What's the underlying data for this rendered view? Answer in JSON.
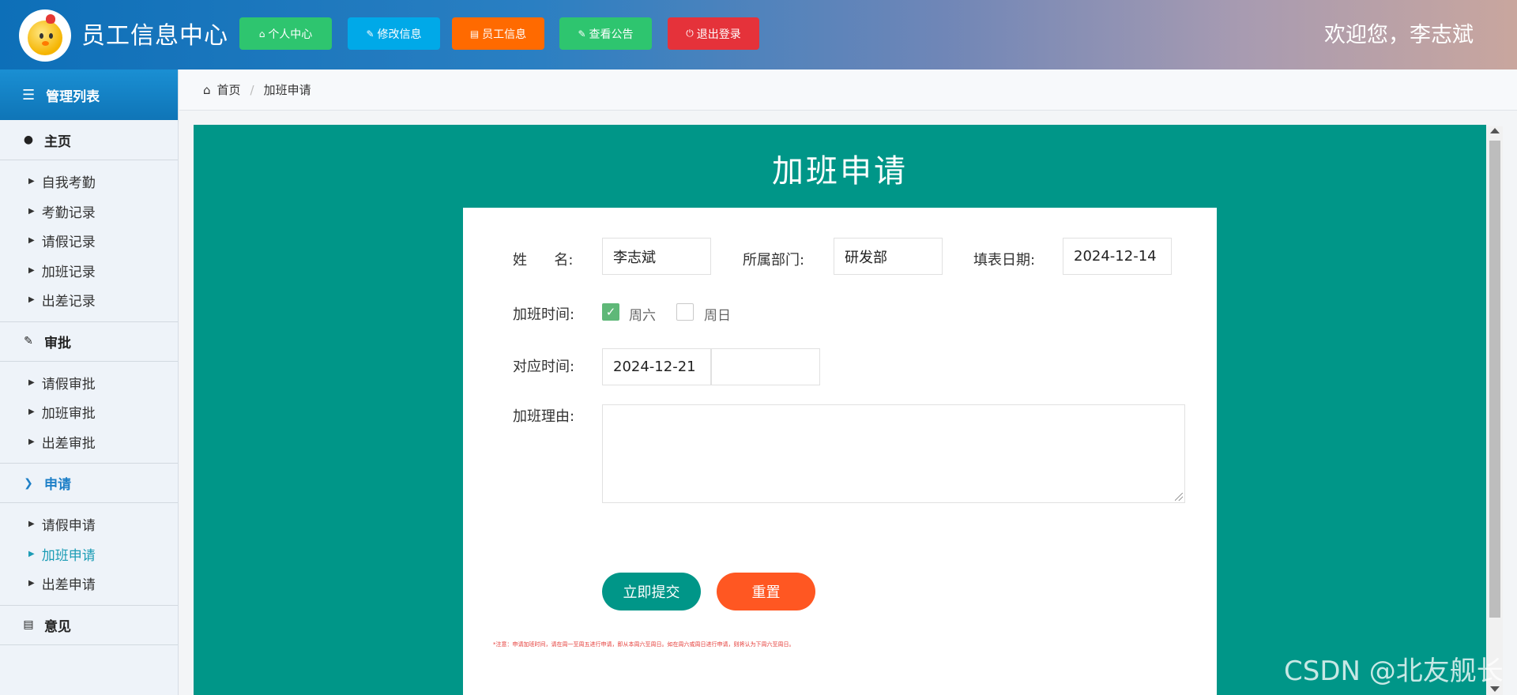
{
  "header": {
    "app_title": "员工信息中心",
    "welcome": "欢迎您，李志斌",
    "buttons": [
      {
        "label": "个人中心",
        "icon": "home-icon",
        "color": "#2ec56f"
      },
      {
        "label": "修改信息",
        "icon": "wrench-icon",
        "color": "#00a9e8"
      },
      {
        "label": "员工信息",
        "icon": "file-icon",
        "color": "#ff6a00"
      },
      {
        "label": "查看公告",
        "icon": "wrench-icon",
        "color": "#2ec56f"
      },
      {
        "label": "退出登录",
        "icon": "power-icon",
        "color": "#e5323a"
      }
    ]
  },
  "sidebar": {
    "title": "管理列表",
    "sections": [
      {
        "title": "主页",
        "icon": "user-icon",
        "items": [
          "自我考勤",
          "考勤记录",
          "请假记录",
          "加班记录",
          "出差记录"
        ]
      },
      {
        "title": "审批",
        "icon": "edit-icon",
        "items": [
          "请假审批",
          "加班审批",
          "出差审批"
        ]
      },
      {
        "title": "申请",
        "icon": "chevron-circle-icon",
        "items": [
          "请假申请",
          "加班申请",
          "出差申请"
        ],
        "active_item": "加班申请"
      },
      {
        "title": "意见",
        "icon": "file-icon",
        "items": []
      }
    ]
  },
  "breadcrumb": {
    "home": "首页",
    "current": "加班申请"
  },
  "form": {
    "title": "加班申请",
    "name_label": "姓      名:",
    "name_value": "李志斌",
    "dept_label": "所属部门:",
    "dept_value": "研发部",
    "date_label": "填表日期:",
    "date_value": "2024-12-14",
    "overtime_label": "加班时间:",
    "options": [
      {
        "label": "周六",
        "checked": true
      },
      {
        "label": "周日",
        "checked": false
      }
    ],
    "corresponding_label": "对应时间:",
    "corresponding_value_1": "2024-12-21",
    "corresponding_value_2": "",
    "reason_label": "加班理由:",
    "reason_value": "",
    "submit_label": "立即提交",
    "reset_label": "重置",
    "note": "*注意：申请加班时间，请在周一至周五进行申请，即从本周六至周日。如在周六或周日进行申请，则将认为下周六至周日。"
  },
  "colors": {
    "accent": "#009688",
    "submit": "#009688",
    "reset": "#ff5722"
  },
  "watermark": "CSDN @北友舰长"
}
